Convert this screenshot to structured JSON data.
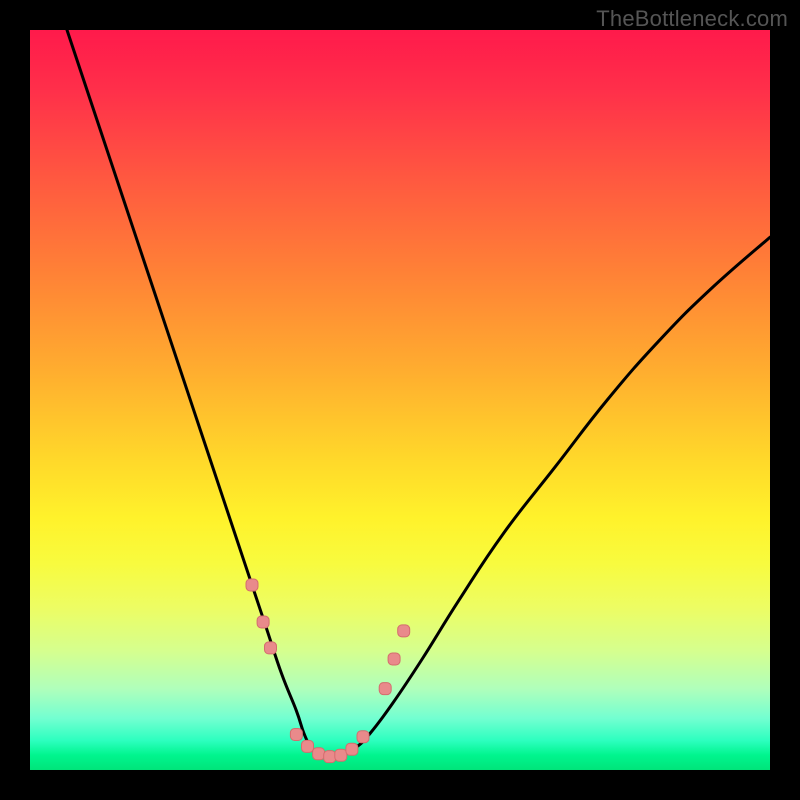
{
  "watermark": "TheBottleneck.com",
  "colors": {
    "frame": "#000000",
    "curve": "#000000",
    "marker_fill": "#e98a8b",
    "marker_stroke": "#d46d6e",
    "gradient_stops": [
      "#ff1a4b",
      "#ff2f4a",
      "#ff5840",
      "#ff8236",
      "#ffad2f",
      "#ffd82a",
      "#fff22b",
      "#f8fb3e",
      "#edfd63",
      "#d5ff8f",
      "#b0ffbb",
      "#73ffd1",
      "#2dffbf",
      "#00f58e",
      "#00e47a"
    ]
  },
  "chart_data": {
    "type": "line",
    "title": "",
    "xlabel": "",
    "ylabel": "",
    "xlim": [
      0,
      100
    ],
    "ylim": [
      0,
      100
    ],
    "grid": false,
    "legend": false,
    "series": [
      {
        "name": "bottleneck-curve",
        "x": [
          5,
          8,
          11,
          14,
          17,
          20,
          23,
          26,
          28,
          30,
          32,
          34,
          36,
          37,
          38,
          39,
          40,
          42,
          44,
          46,
          49,
          53,
          58,
          64,
          71,
          78,
          85,
          92,
          100
        ],
        "y": [
          100,
          91,
          82,
          73,
          64,
          55,
          46,
          37,
          31,
          25,
          19,
          13,
          8,
          5,
          3,
          2,
          2,
          2,
          3,
          5,
          9,
          15,
          23,
          32,
          41,
          50,
          58,
          65,
          72
        ]
      }
    ],
    "markers": [
      {
        "x": 30.0,
        "y": 25.0
      },
      {
        "x": 31.5,
        "y": 20.0
      },
      {
        "x": 32.5,
        "y": 16.5
      },
      {
        "x": 36.0,
        "y": 4.8
      },
      {
        "x": 37.5,
        "y": 3.2
      },
      {
        "x": 39.0,
        "y": 2.2
      },
      {
        "x": 40.5,
        "y": 1.8
      },
      {
        "x": 42.0,
        "y": 2.0
      },
      {
        "x": 43.5,
        "y": 2.8
      },
      {
        "x": 45.0,
        "y": 4.5
      },
      {
        "x": 48.0,
        "y": 11.0
      },
      {
        "x": 49.2,
        "y": 15.0
      },
      {
        "x": 50.5,
        "y": 18.8
      }
    ],
    "marker_size_px": 12,
    "curve_stroke_px": 3
  }
}
